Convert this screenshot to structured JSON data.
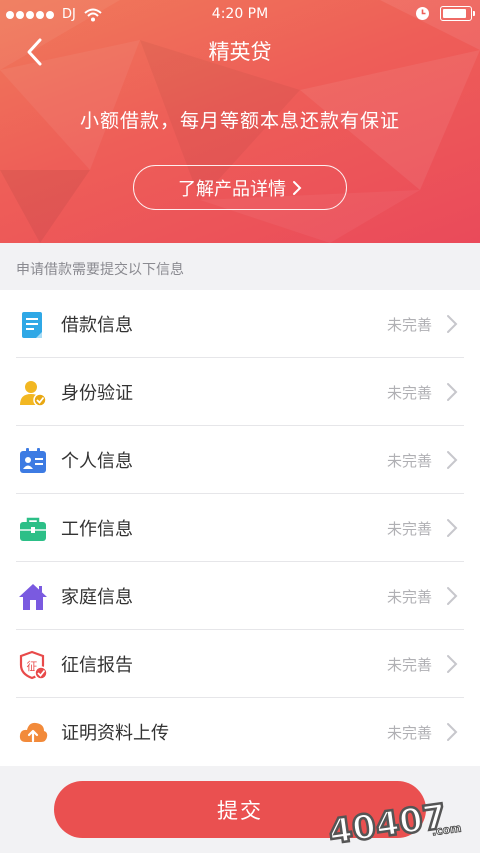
{
  "status_bar": {
    "carrier": "DJ",
    "time": "4:20 PM",
    "battery_level": 0.9
  },
  "nav": {
    "title": "精英贷",
    "back_icon": "chevron-left-icon"
  },
  "hero": {
    "slogan": "小额借款，每月等额本息还款有保证",
    "detail_button": "了解产品详情"
  },
  "section_label": "申请借款需要提交以下信息",
  "items": [
    {
      "label": "借款信息",
      "status": "未完善",
      "icon": "document-icon",
      "color": "#2fa8e6"
    },
    {
      "label": "身份验证",
      "status": "未完善",
      "icon": "user-verified-icon",
      "color": "#f2b722"
    },
    {
      "label": "个人信息",
      "status": "未完善",
      "icon": "id-card-icon",
      "color": "#3d7be3"
    },
    {
      "label": "工作信息",
      "status": "未完善",
      "icon": "briefcase-icon",
      "color": "#2cbf87"
    },
    {
      "label": "家庭信息",
      "status": "未完善",
      "icon": "home-icon",
      "color": "#7a5ae0"
    },
    {
      "label": "征信报告",
      "status": "未完善",
      "icon": "credit-shield-icon",
      "color": "#e84a4a"
    },
    {
      "label": "证明资料上传",
      "status": "未完善",
      "icon": "cloud-upload-icon",
      "color": "#f28a3a"
    }
  ],
  "submit_label": "提交",
  "watermark_text": "40407.com",
  "colors": {
    "brand": "#ea5050",
    "hero_top": "#f07a5a",
    "hero_bottom": "#ea4a5a"
  }
}
